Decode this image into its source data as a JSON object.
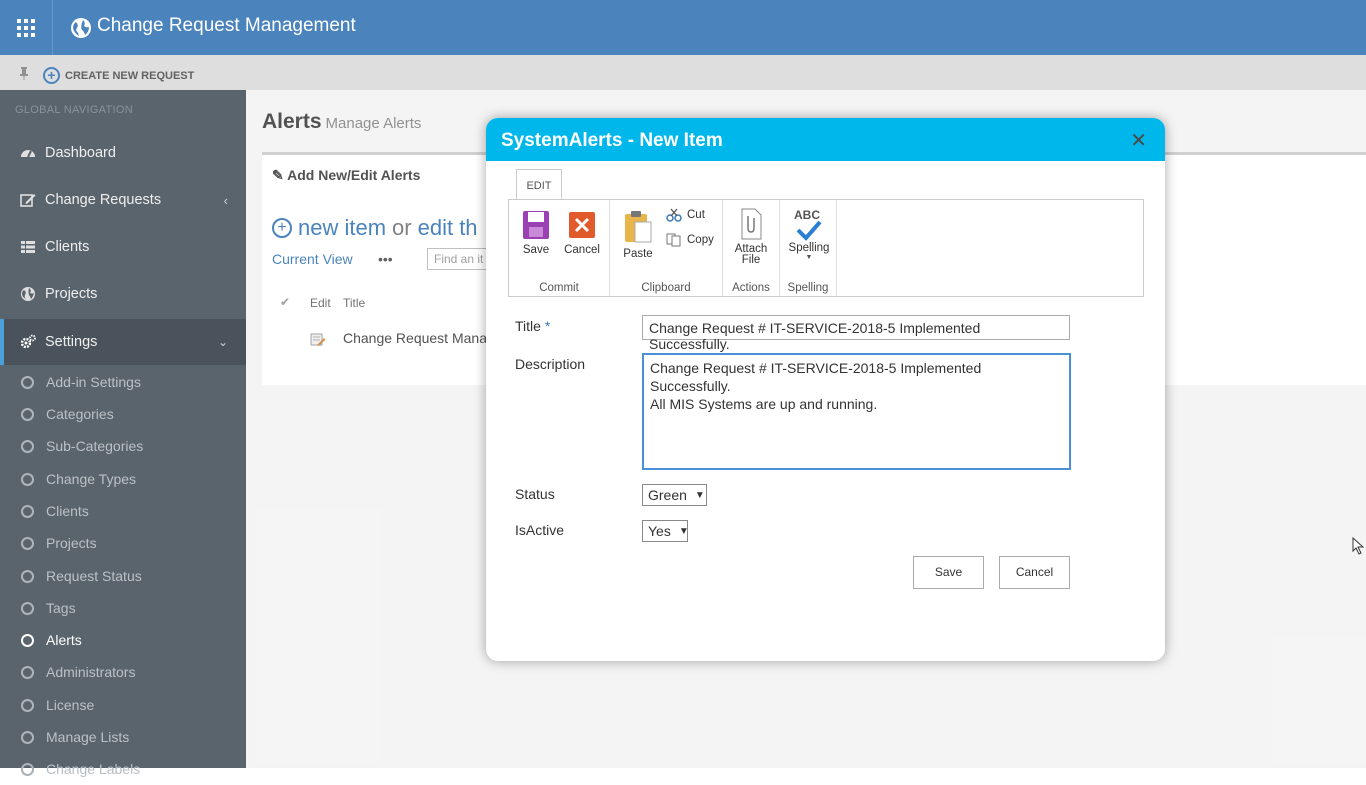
{
  "app": {
    "title": "Change Request Management"
  },
  "subbar": {
    "create_label": "CREATE NEW REQUEST"
  },
  "sidebar": {
    "header": "GLOBAL NAVIGATION",
    "items": [
      {
        "label": "Dashboard"
      },
      {
        "label": "Change Requests"
      },
      {
        "label": "Clients"
      },
      {
        "label": "Projects"
      },
      {
        "label": "Settings"
      }
    ],
    "settings_items": [
      {
        "label": "Add-in Settings"
      },
      {
        "label": "Categories"
      },
      {
        "label": "Sub-Categories"
      },
      {
        "label": "Change Types"
      },
      {
        "label": "Clients"
      },
      {
        "label": "Projects"
      },
      {
        "label": "Request Status"
      },
      {
        "label": "Tags"
      },
      {
        "label": "Alerts"
      },
      {
        "label": "Administrators"
      },
      {
        "label": "License"
      },
      {
        "label": "Manage Lists"
      },
      {
        "label": "Change Labels"
      }
    ]
  },
  "main": {
    "title": "Alerts",
    "subtitle": "Manage Alerts",
    "panel_title": "Add New/Edit Alerts",
    "new_item": "new item",
    "or": "or",
    "edit": "edit th",
    "current_view": "Current View",
    "more": "•••",
    "find_placeholder": "Find an it",
    "columns": {
      "edit": "Edit",
      "title": "Title"
    },
    "row_title": "Change Request Manag"
  },
  "dialog": {
    "title": "SystemAlerts - New Item",
    "ribbon_tab": "EDIT",
    "ribbon": {
      "save": "Save",
      "cancel": "Cancel",
      "commit": "Commit",
      "paste": "Paste",
      "cut": "Cut",
      "copy": "Copy",
      "clipboard": "Clipboard",
      "attach": "Attach",
      "file": "File",
      "actions": "Actions",
      "spelling": "Spelling",
      "spelling_group": "Spelling",
      "abc": "ABC"
    },
    "fields": {
      "title_label": "Title",
      "required_mark": "*",
      "title_value": "Change Request # IT-SERVICE-2018-5 Implemented Successfully.",
      "description_label": "Description",
      "description_value": "Change Request # IT-SERVICE-2018-5 Implemented Successfully.\nAll MIS Systems are up and running.",
      "status_label": "Status",
      "status_value": "Green",
      "isactive_label": "IsActive",
      "isactive_value": "Yes"
    },
    "buttons": {
      "save": "Save",
      "cancel": "Cancel"
    }
  },
  "colors": {
    "topbar": "#3c7ab8",
    "dialog_header": "#00b7eb",
    "sidebar": "#4c5761"
  }
}
